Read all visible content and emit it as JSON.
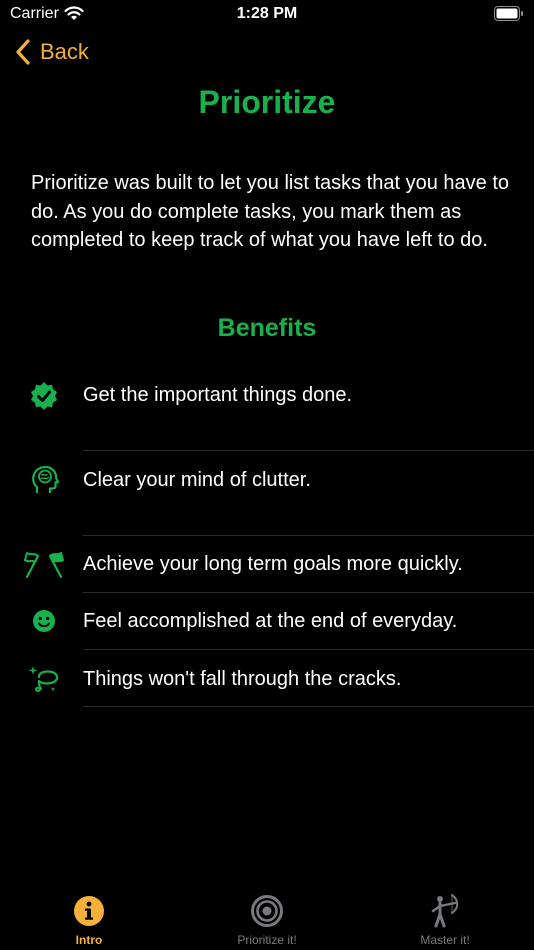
{
  "status_bar": {
    "carrier": "Carrier",
    "time": "1:28 PM"
  },
  "nav": {
    "back_label": "Back"
  },
  "page": {
    "title": "Prioritize",
    "intro": "Prioritize was built to let you list tasks that you have to do. As you do complete tasks, you mark them as completed to keep track of what you have left to do.",
    "benefits_title": "Benefits"
  },
  "benefits": [
    {
      "label": "Get the important things done.",
      "icon": "checkmark-seal-icon"
    },
    {
      "label": "Clear your mind of clutter.",
      "icon": "brain-head-icon"
    },
    {
      "label": "Achieve your long term goals more quickly.",
      "icon": "flags-icon"
    },
    {
      "label": "Feel accomplished at the end of everyday.",
      "icon": "smiley-icon"
    },
    {
      "label": "Things won't fall through the cracks.",
      "icon": "lasso-sparkles-icon"
    }
  ],
  "tabs": [
    {
      "label": "Intro",
      "icon": "info-icon",
      "active": true
    },
    {
      "label": "Prioritize it!",
      "icon": "target-icon",
      "active": false
    },
    {
      "label": "Master it!",
      "icon": "archery-icon",
      "active": false
    }
  ],
  "colors": {
    "accent": "#f4b03a",
    "green": "#18b14d",
    "background": "#000000",
    "inactive": "#7a7a7e"
  }
}
